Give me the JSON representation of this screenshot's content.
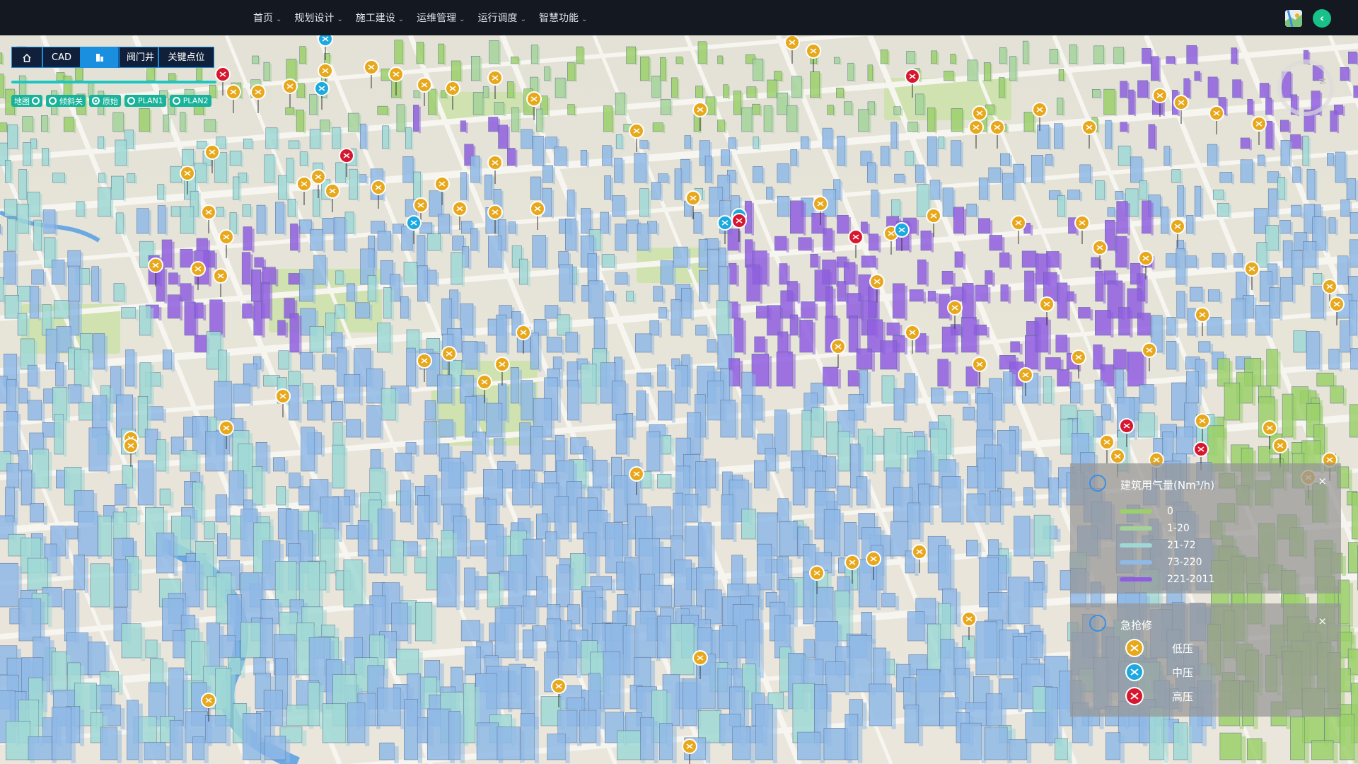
{
  "nav": {
    "items": [
      {
        "label": "首页"
      },
      {
        "label": "规划设计"
      },
      {
        "label": "施工建设"
      },
      {
        "label": "运维管理"
      },
      {
        "label": "运行调度"
      },
      {
        "label": "智慧功能"
      }
    ]
  },
  "header_icons": {
    "map_switch": "map-thumbnail-icon",
    "collapse": "chevron-left-icon"
  },
  "toolbar": {
    "home_icon": "home-icon",
    "cad_label": "CAD",
    "building_icon": "building-icon",
    "valve_label": "阀门井",
    "keypoint_label": "关键点位"
  },
  "layer_toggles": [
    {
      "label": "地图",
      "on": false
    },
    {
      "label": "倾斜关",
      "on": false
    },
    {
      "label": "原始",
      "on": true
    },
    {
      "label": "PLAN1",
      "on": false
    },
    {
      "label": "PLAN2",
      "on": false
    }
  ],
  "compass": {
    "letter": "N"
  },
  "legend_gas": {
    "title": "建筑用气量(Nm³/h)",
    "close": "×",
    "items": [
      {
        "label": "0",
        "color": "#9bd06a"
      },
      {
        "label": "1-20",
        "color": "#a3d39a"
      },
      {
        "label": "21-72",
        "color": "#9fd8d5"
      },
      {
        "label": "73-220",
        "color": "#8fb9e6"
      },
      {
        "label": "221-2011",
        "color": "#8f5ee0"
      }
    ]
  },
  "legend_repair": {
    "title": "急抢修",
    "close": "×",
    "items": [
      {
        "label": "低压",
        "color": "#e8a81c"
      },
      {
        "label": "中压",
        "color": "#1ca9e0"
      },
      {
        "label": "高压",
        "color": "#d7172f"
      }
    ]
  },
  "colors": {
    "bldg_none": "#9bd06a",
    "bldg_low": "#a3d39a",
    "bldg_mid": "#9fd8d5",
    "bldg_high": "#8fb9e6",
    "bldg_top": "#8f5ee0",
    "pin_low": "#e8a81c",
    "pin_mid": "#1ca9e0",
    "pin_high": "#d7172f",
    "topbar": "#141821",
    "accent": "#1a8fe0"
  }
}
